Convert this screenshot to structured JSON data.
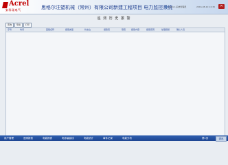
{
  "brand": {
    "name": "Acrel",
    "sub": "安科瑞电气"
  },
  "app": {
    "title": "思格尔注塑机械（常州）有限公司新建工程项目 电力监控系统"
  },
  "header": {
    "user": "admin 系统管理员",
    "status": "2016-08-10 14:30"
  },
  "page": {
    "title": "遥 测 历 史 报 警"
  },
  "toolbar": {
    "query": "查询",
    "export": "导出",
    "print": "打印"
  },
  "table": {
    "columns": [
      "序号",
      "时间",
      "回路名称",
      "报警类型",
      "状态位",
      "报警值",
      "限值",
      "报警内容",
      "报警原因",
      "处理措施",
      "确认人员"
    ]
  },
  "footer": {
    "items": [
      "用户管理",
      "遥测报表",
      "电能报表",
      "电参量曲线",
      "电能统计",
      "事件记录",
      "电能分析"
    ],
    "page_info": "第1页",
    "exit": "退出"
  }
}
